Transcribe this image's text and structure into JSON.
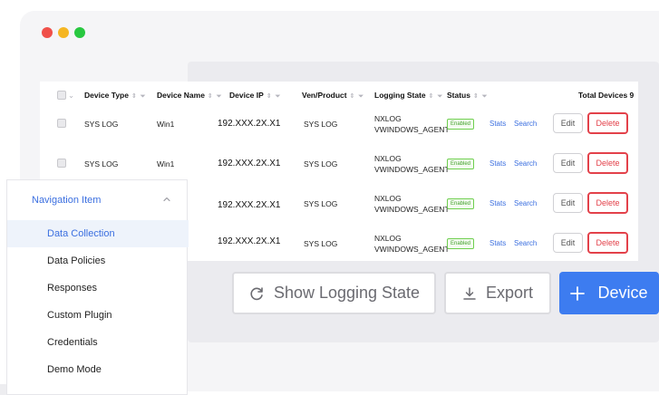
{
  "window": {
    "dots": [
      {
        "name": "close",
        "color": "#f0504a"
      },
      {
        "name": "minimize",
        "color": "#f5b623"
      },
      {
        "name": "zoom",
        "color": "#28c840"
      }
    ]
  },
  "table": {
    "headers": {
      "device_type": "Device Type",
      "device_name": "Device Name",
      "device_ip": "Device IP",
      "ven_product": "Ven/Product",
      "logging_state": "Logging State",
      "status": "Status",
      "total": "Total Devices 9"
    },
    "rows": [
      {
        "type": "SYS LOG",
        "name": "Win1",
        "ip": "192.XXX.2X.X1",
        "product": "SYS LOG",
        "log1": "NXLOG",
        "log2": "VWINDOWS_AGENT",
        "status": "Enabled",
        "stats": "Stats",
        "search": "Search",
        "edit": "Edit",
        "delete": "Delete"
      },
      {
        "type": "SYS LOG",
        "name": "Win1",
        "ip": "192.XXX.2X.X1",
        "product": "SYS LOG",
        "log1": "NXLOG",
        "log2": "VWINDOWS_AGENT",
        "status": "Enabled",
        "stats": "Stats",
        "search": "Search",
        "edit": "Edit",
        "delete": "Delete"
      },
      {
        "type": "",
        "name": "",
        "ip": "192.XXX.2X.X1",
        "product": "SYS LOG",
        "log1": "NXLOG",
        "log2": "VWINDOWS_AGENT",
        "status": "Enabled",
        "stats": "Stats",
        "search": "Search",
        "edit": "Edit",
        "delete": "Delete"
      },
      {
        "type": "",
        "name": "",
        "ip": "192.XXX.2X.X1",
        "product": "SYS LOG",
        "log1": "NXLOG",
        "log2": "VWINDOWS_AGENT",
        "status": "Enabled",
        "stats": "Stats",
        "search": "Search",
        "edit": "Edit",
        "delete": "Delete"
      }
    ]
  },
  "actions": {
    "show_logging_state": "Show Logging State",
    "export": "Export",
    "add_device": "Device"
  },
  "nav": {
    "header": "Navigation Item",
    "items": [
      {
        "label": "Data Collection",
        "active": true
      },
      {
        "label": "Data Policies",
        "active": false
      },
      {
        "label": "Responses",
        "active": false
      },
      {
        "label": "Custom Plugin",
        "active": false
      },
      {
        "label": "Credentials",
        "active": false
      },
      {
        "label": "Demo Mode",
        "active": false
      }
    ]
  },
  "colors": {
    "accent": "#3d7cf0",
    "danger": "#e3414a",
    "success": "#6fcf4f"
  }
}
